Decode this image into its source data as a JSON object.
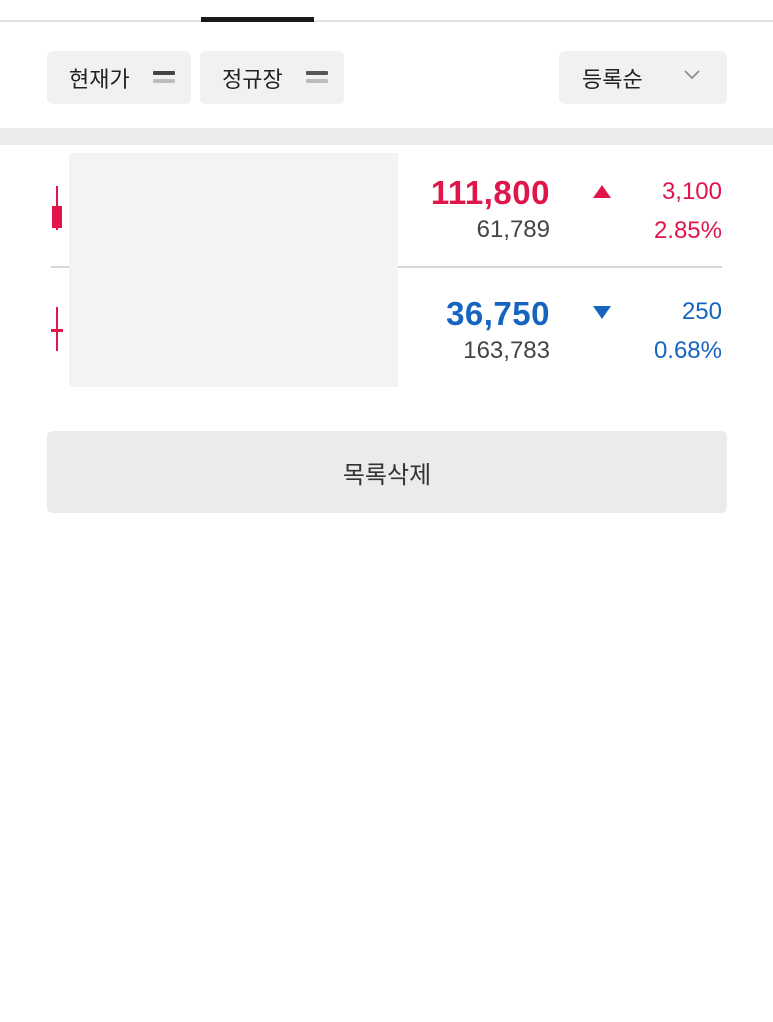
{
  "filters": {
    "price_chip_label": "현재가",
    "session_chip_label": "정규장",
    "sort_label": "등록순"
  },
  "stocks": [
    {
      "price": "111,800",
      "volume": "61,789",
      "change": "3,100",
      "change_rate": "2.85%",
      "direction": "up"
    },
    {
      "price": "36,750",
      "volume": "163,783",
      "change": "250",
      "change_rate": "0.68%",
      "direction": "down"
    }
  ],
  "actions": {
    "delete_list_label": "목록삭제"
  },
  "colors": {
    "up": "#e0154a",
    "down": "#1565c0"
  }
}
